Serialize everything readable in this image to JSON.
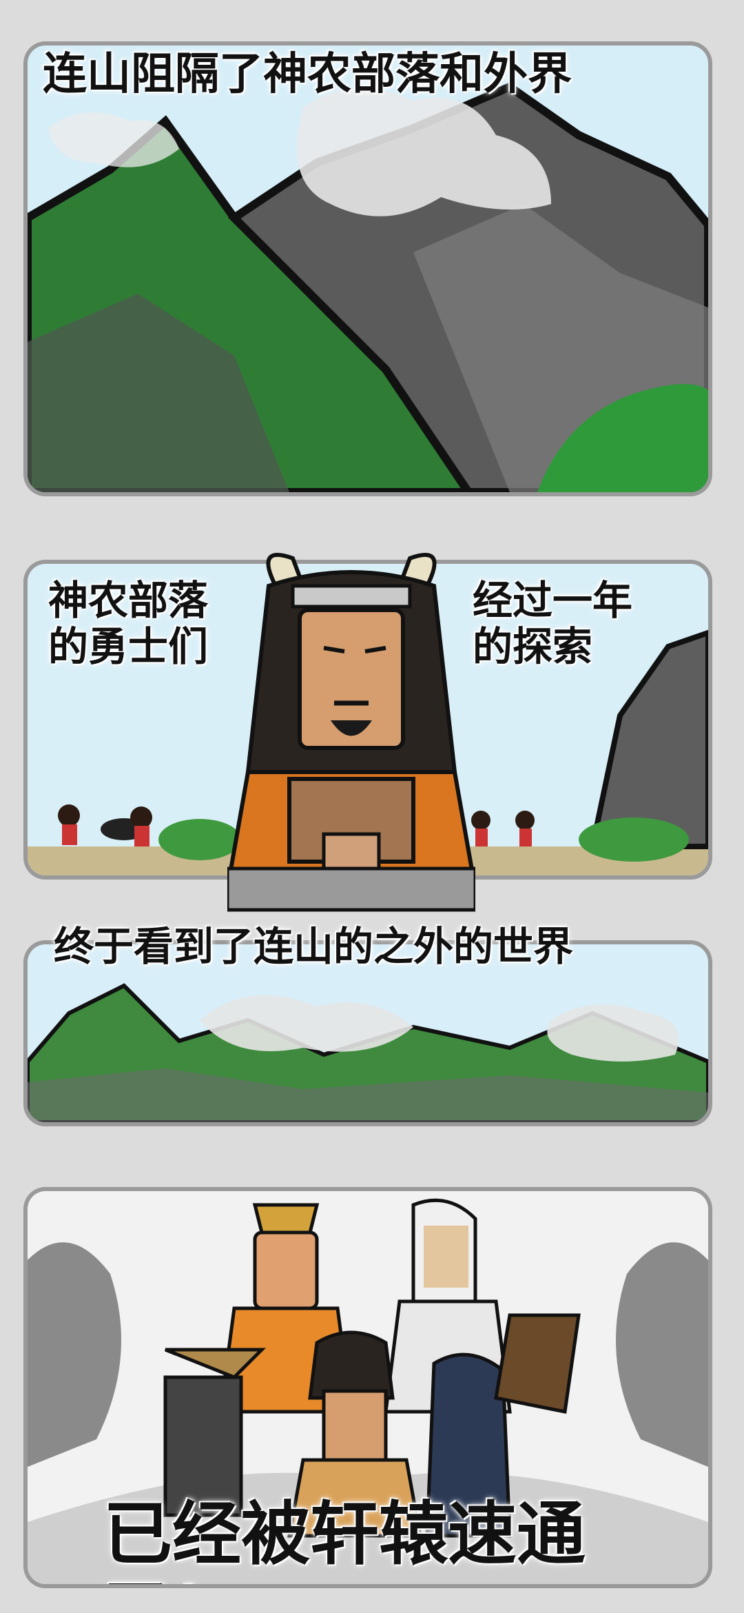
{
  "panels": [
    {
      "caption": "连山阻隔了神农部落和外界"
    },
    {
      "caption_left": "神农部落\n的勇士们",
      "caption_right": "经过一年\n的探索"
    },
    {
      "caption": "终于看到了连山的之外的世界"
    },
    {
      "caption": "已经被轩辕速通了！"
    }
  ],
  "colors": {
    "sky": "#cfe9f5",
    "mountain_green": "#3a8a3a",
    "mountain_gray": "#6a6a6a",
    "cloud": "#e6e6e6"
  }
}
